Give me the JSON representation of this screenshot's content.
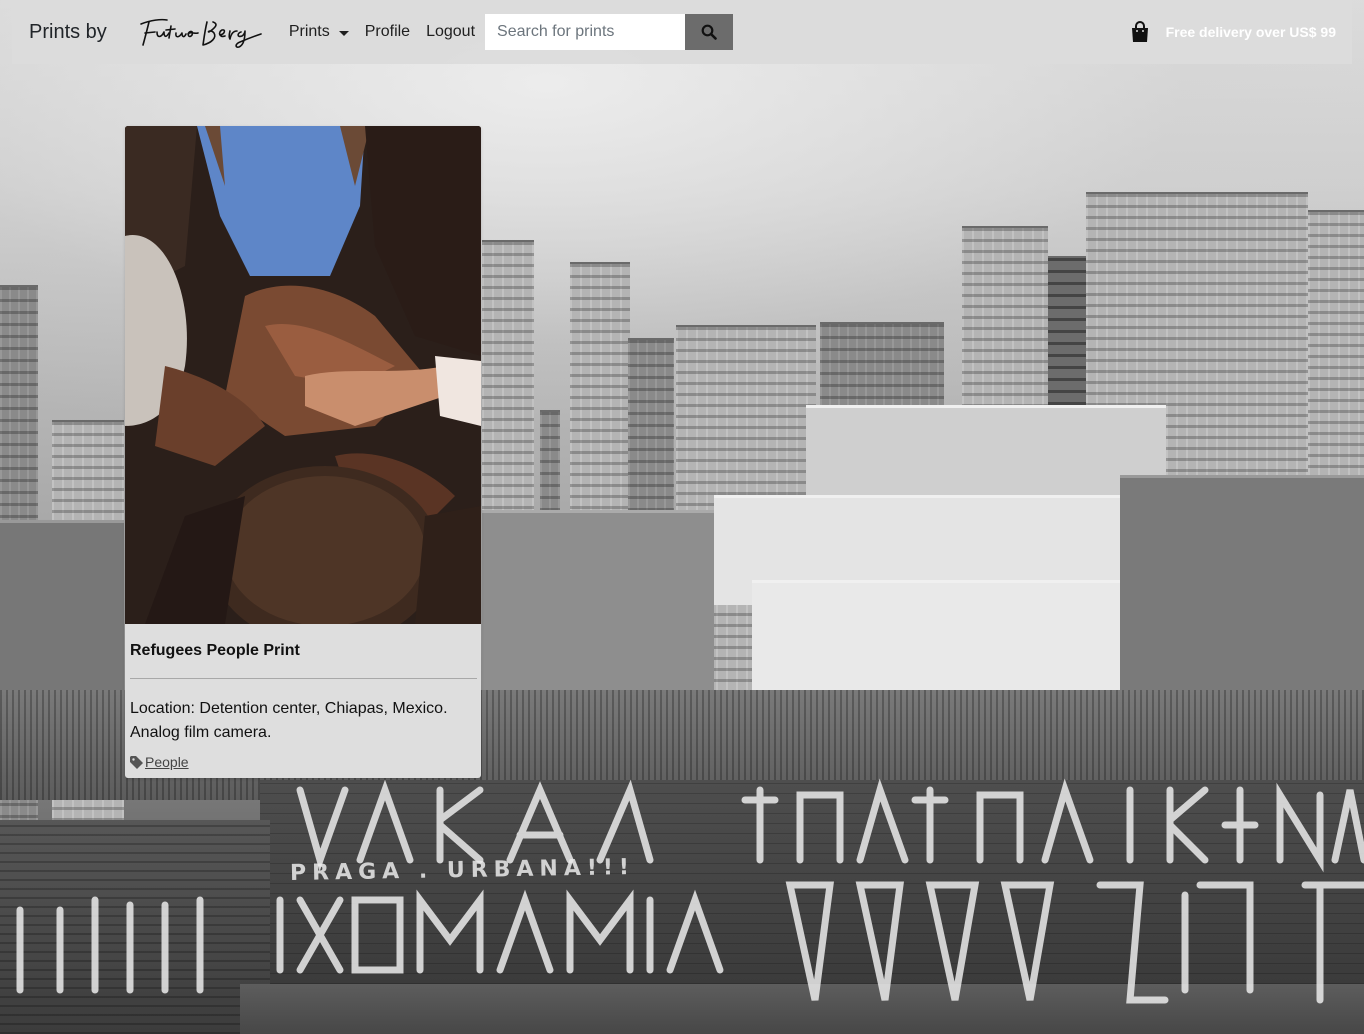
{
  "navbar": {
    "brand_prefix": "Prints by",
    "logo": "Futuro Berg",
    "links": [
      {
        "label": "Prints",
        "has_dropdown": true
      },
      {
        "label": "Profile"
      },
      {
        "label": "Logout"
      }
    ],
    "search": {
      "placeholder": "Search for prints",
      "value": "",
      "button_icon": "search-icon"
    },
    "cart_icon": "shopping-bag-icon",
    "delivery_text": "Free delivery over US$ 99"
  },
  "background": {
    "graffiti_lines": [
      "PRAGA . URBANA!!!"
    ]
  },
  "card": {
    "title": "Refugees People Print",
    "description": "Location: Detention center, Chiapas, Mexico. Analog film camera.",
    "tag_icon": "tag-icon",
    "tag": "People"
  },
  "colors": {
    "navbar_bg": "#dcdcdc",
    "search_button": "#6c6c6c",
    "delivery_text": "#ffffff",
    "card_bg": "#dedede"
  }
}
